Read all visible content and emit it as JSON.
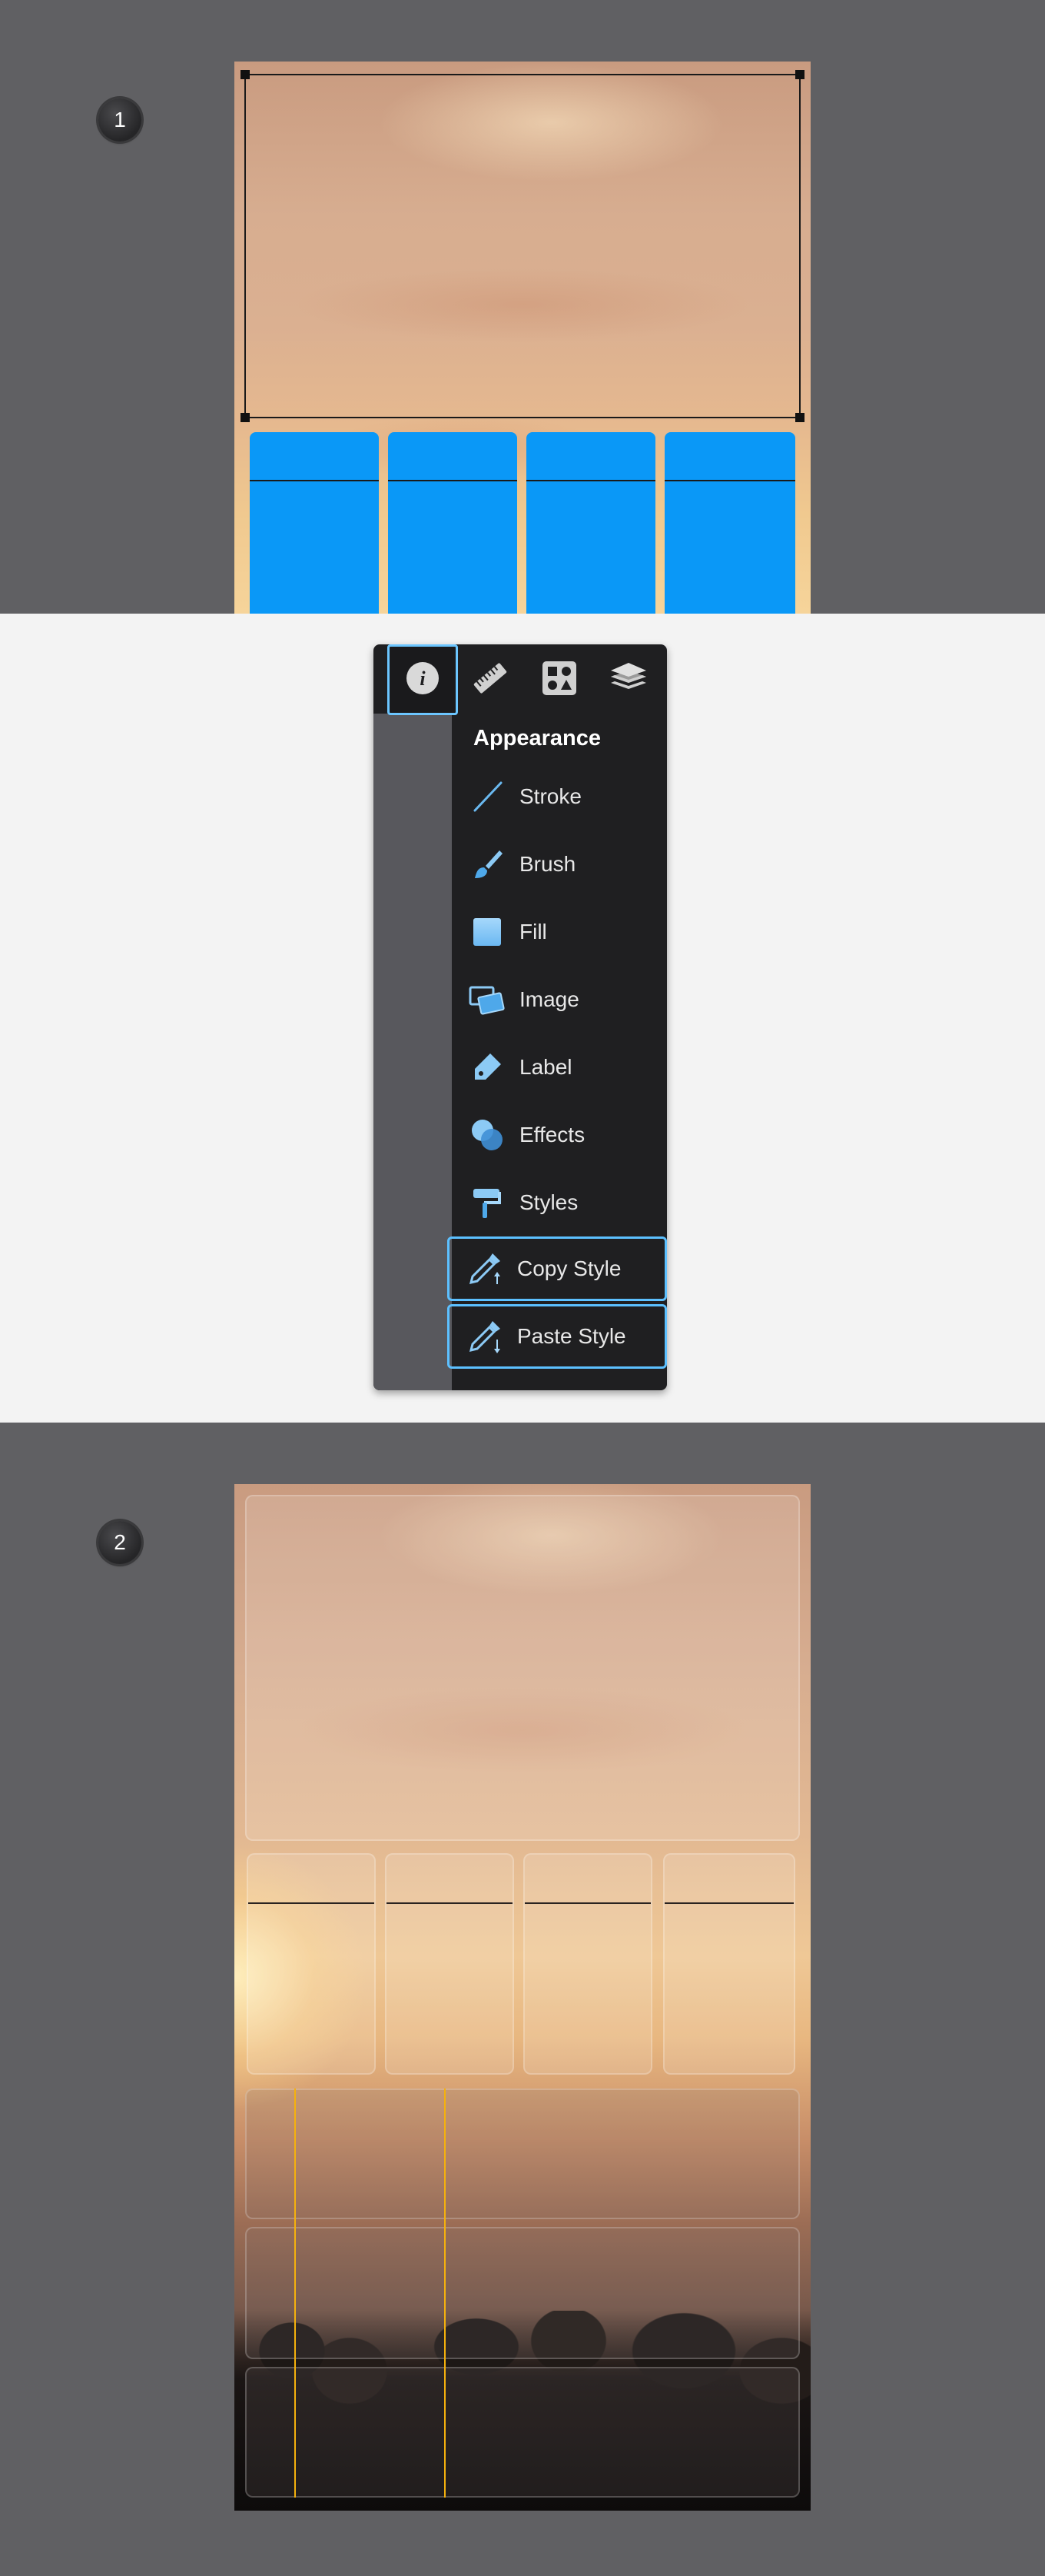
{
  "steps": {
    "first": "1",
    "second": "2"
  },
  "toolbox": {
    "tabs": [
      {
        "name": "info-icon",
        "active": true
      },
      {
        "name": "ruler-icon",
        "active": false
      },
      {
        "name": "shapes-icon",
        "active": false
      },
      {
        "name": "layers-icon",
        "active": false
      }
    ],
    "section_title": "Appearance",
    "items": [
      {
        "label": "Stroke",
        "icon": "stroke-icon",
        "highlighted": false
      },
      {
        "label": "Brush",
        "icon": "brush-icon",
        "highlighted": false
      },
      {
        "label": "Fill",
        "icon": "fill-icon",
        "highlighted": false
      },
      {
        "label": "Image",
        "icon": "image-icon",
        "highlighted": false
      },
      {
        "label": "Label",
        "icon": "label-icon",
        "highlighted": false
      },
      {
        "label": "Effects",
        "icon": "effects-icon",
        "highlighted": false
      },
      {
        "label": "Styles",
        "icon": "styles-icon",
        "highlighted": false
      },
      {
        "label": "Copy Style",
        "icon": "copy-style-icon",
        "highlighted": true
      },
      {
        "label": "Paste Style",
        "icon": "paste-style-icon",
        "highlighted": true
      }
    ]
  },
  "colors": {
    "accent_blue": "#0a98f7",
    "highlight": "#5cc0ff",
    "guide": "#f5b10d",
    "canvas_bg": "#606063"
  }
}
